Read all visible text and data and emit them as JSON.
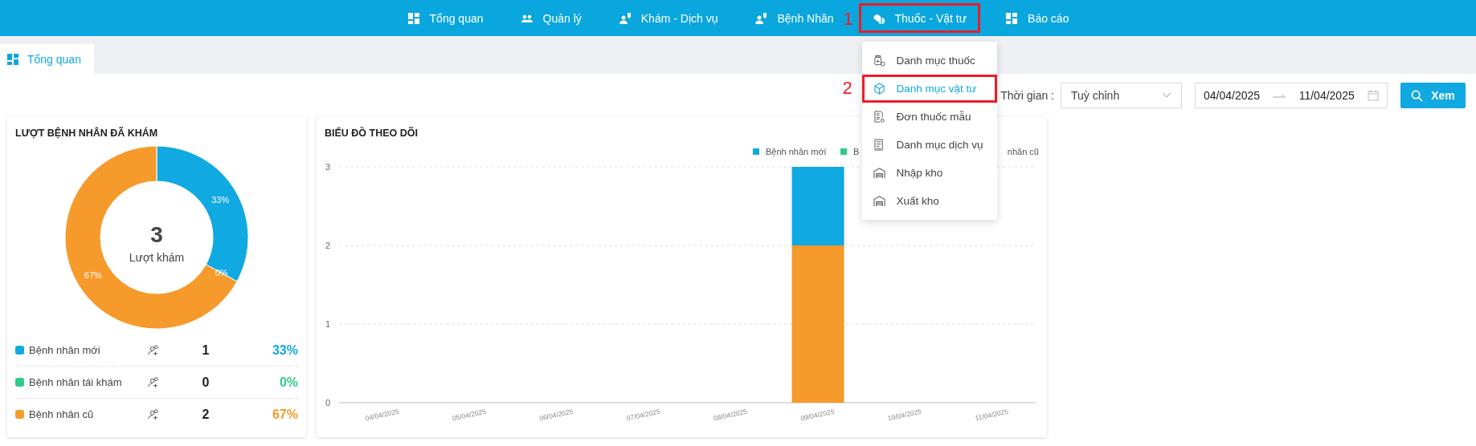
{
  "nav": {
    "items": [
      {
        "label": "Tổng quan",
        "expanded": false,
        "highlighted": false
      },
      {
        "label": "Quản lý",
        "expanded": false,
        "highlighted": false
      },
      {
        "label": "Khám - Dịch vụ",
        "expanded": false,
        "highlighted": false
      },
      {
        "label": "Bệnh Nhân",
        "expanded": false,
        "highlighted": false
      },
      {
        "label": "Thuốc - Vật tư",
        "expanded": true,
        "highlighted": true,
        "marker": "1"
      },
      {
        "label": "Báo cáo",
        "expanded": false,
        "highlighted": false
      }
    ]
  },
  "dropdown": {
    "items": [
      {
        "label": "Danh mục thuốc",
        "selected": false,
        "highlighted": false
      },
      {
        "label": "Danh mục vật tư",
        "selected": true,
        "highlighted": true,
        "marker": "2"
      },
      {
        "label": "Đơn thuốc mẫu",
        "selected": false,
        "highlighted": false
      },
      {
        "label": "Danh mục dịch vụ",
        "selected": false,
        "highlighted": false
      },
      {
        "label": "Nhập kho",
        "selected": false,
        "highlighted": false
      },
      {
        "label": "Xuất kho",
        "selected": false,
        "highlighted": false
      }
    ]
  },
  "tabs": [
    {
      "label": "Tổng quan",
      "selected": true
    }
  ],
  "filter": {
    "label": "Thời gian :",
    "period": "Tuỳ chỉnh",
    "date_from": "04/04/2025",
    "date_to": "11/04/2025",
    "button": "Xem"
  },
  "patient_summary": {
    "title": "LƯỢT BỆNH NHÂN ĐÃ KHÁM",
    "total": "3",
    "total_label": "Lượt khám",
    "chart_data": {
      "type": "donut",
      "values": [
        33,
        0,
        67
      ],
      "value_labels": [
        "33%",
        "0%",
        "67%"
      ]
    },
    "rows": [
      {
        "label": "Bệnh nhân mới",
        "count": "1",
        "percent": "33%",
        "color": "#10a9e1"
      },
      {
        "label": "Bệnh nhân tái khám",
        "count": "0",
        "percent": "0%",
        "color": "#2ecb8a"
      },
      {
        "label": "Bệnh nhân cũ",
        "count": "2",
        "percent": "67%",
        "color": "#f69a2b"
      }
    ]
  },
  "tracking": {
    "title": "BIỂU ĐỒ THEO DÕI",
    "legend": [
      {
        "label": "Bệnh nhân mới",
        "color": "#10a9e1"
      },
      {
        "label": "B",
        "color": "#2ecb8a"
      },
      {
        "label": "nhân cũ"
      }
    ],
    "chart_data": {
      "type": "bar",
      "stacked": true,
      "categories": [
        "04/04/2025",
        "05/04/2025",
        "06/04/2025",
        "07/04/2025",
        "08/04/2025",
        "09/04/2025",
        "10/04/2025",
        "11/04/2025"
      ],
      "series": [
        {
          "color": "#10a9e1",
          "values": [
            0,
            0,
            0,
            0,
            0,
            1,
            0,
            0
          ]
        },
        {
          "values": [
            0,
            0,
            0,
            0,
            0,
            0,
            0,
            0
          ]
        },
        {
          "color": "#f69a2b",
          "values": [
            0,
            0,
            0,
            0,
            0,
            2,
            0,
            0
          ]
        }
      ],
      "ylim": [
        0,
        3
      ],
      "yticks": [
        0,
        1,
        2,
        3
      ]
    }
  }
}
